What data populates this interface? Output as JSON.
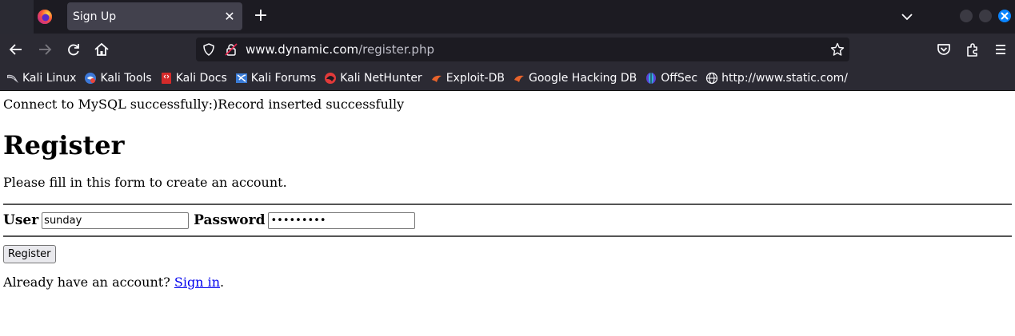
{
  "window": {
    "tab_title": "Sign Up",
    "tab_close_icon": "close-icon",
    "new_tab_icon": "plus-icon"
  },
  "navigation": {
    "url_host": "www.dynamic.com",
    "url_path": "/register.php",
    "icons": [
      "back-icon",
      "forward-icon",
      "reload-icon",
      "home-icon",
      "shield-icon",
      "lock-icon",
      "star-icon",
      "pocket-icon",
      "extensions-icon",
      "menu-icon"
    ]
  },
  "bookmarks": [
    {
      "label": "Kali Linux",
      "icon": "kali-dragon-icon"
    },
    {
      "label": "Kali Tools",
      "icon": "kali-tools-icon"
    },
    {
      "label": "Kali Docs",
      "icon": "kali-docs-icon"
    },
    {
      "label": "Kali Forums",
      "icon": "kali-forums-icon"
    },
    {
      "label": "Kali NetHunter",
      "icon": "nethunter-icon"
    },
    {
      "label": "Exploit-DB",
      "icon": "exploit-db-icon"
    },
    {
      "label": "Google Hacking DB",
      "icon": "ghdb-icon"
    },
    {
      "label": "OffSec",
      "icon": "offsec-icon"
    },
    {
      "label": "http://www.static.com/",
      "icon": "globe-icon"
    }
  ],
  "page": {
    "status_message": "Connect to MySQL successfully:)Record inserted successfully",
    "title": "Register",
    "subtitle": "Please fill in this form to create an account.",
    "user_label": "User",
    "user_value": "sunday",
    "password_label": "Password",
    "password_value": "sunday123",
    "register_button": "Register",
    "signin_prompt": "Already have an account? ",
    "signin_link": "Sign in",
    "signin_suffix": "."
  },
  "colors": {
    "tabbar_bg": "#1c1b22",
    "toolbar_bg": "#2b2a33",
    "accent": "#0a84ff",
    "link": "#0000ee"
  }
}
